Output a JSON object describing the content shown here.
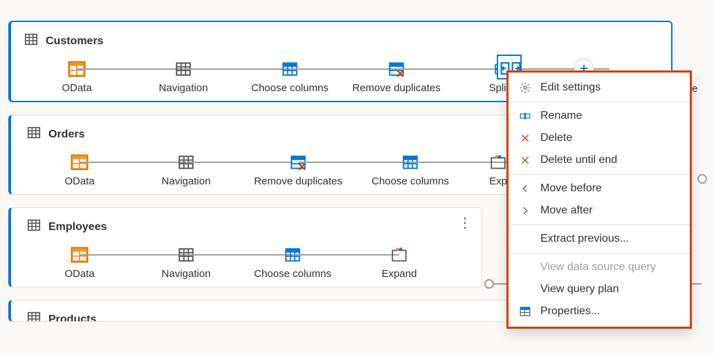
{
  "queries": [
    {
      "name": "Customers",
      "steps": [
        "OData",
        "Navigation",
        "Choose columns",
        "Remove duplicates",
        "Split c"
      ],
      "extra_steps_hint": true
    },
    {
      "name": "Orders",
      "steps": [
        "OData",
        "Navigation",
        "Remove duplicates",
        "Choose columns",
        "Exp"
      ]
    },
    {
      "name": "Employees",
      "steps": [
        "OData",
        "Navigation",
        "Choose columns",
        "Expand"
      ]
    },
    {
      "name": "Products",
      "steps": []
    }
  ],
  "right_label": "Filte",
  "context_menu": {
    "edit_settings": "Edit settings",
    "rename": "Rename",
    "delete": "Delete",
    "delete_until_end": "Delete until end",
    "move_before": "Move before",
    "move_after": "Move after",
    "extract_previous": "Extract previous...",
    "view_data_source": "View data source query",
    "view_query_plan": "View query plan",
    "properties": "Properties..."
  }
}
